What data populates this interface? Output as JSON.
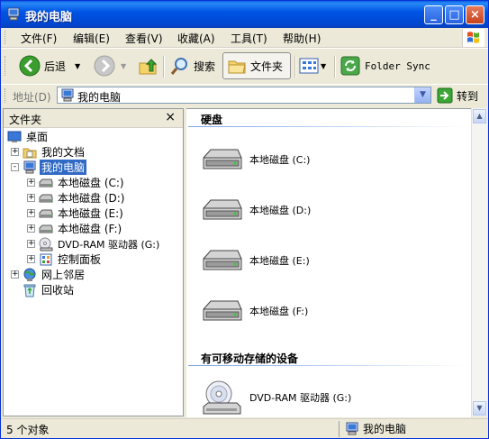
{
  "window": {
    "title": "我的电脑"
  },
  "menu": [
    "文件(F)",
    "编辑(E)",
    "查看(V)",
    "收藏(A)",
    "工具(T)",
    "帮助(H)"
  ],
  "toolbar": {
    "back": "后退",
    "search": "搜索",
    "folders": "文件夹",
    "folder_sync": "Folder Sync"
  },
  "address": {
    "label": "地址(D)",
    "value": "我的电脑",
    "go": "转到"
  },
  "folder_pane": {
    "title": "文件夹",
    "close": "×",
    "items": [
      {
        "label": "桌面",
        "level": 0
      },
      {
        "label": "我的文档",
        "level": 1,
        "expander": "+"
      },
      {
        "label": "我的电脑",
        "level": 1,
        "expander": "-",
        "selected": true
      },
      {
        "label": "本地磁盘 (C:)",
        "level": 2,
        "expander": "+"
      },
      {
        "label": "本地磁盘 (D:)",
        "level": 2,
        "expander": "+"
      },
      {
        "label": "本地磁盘 (E:)",
        "level": 2,
        "expander": "+"
      },
      {
        "label": "本地磁盘 (F:)",
        "level": 2,
        "expander": "+"
      },
      {
        "label": "DVD-RAM 驱动器 (G:)",
        "level": 2,
        "expander": "+"
      },
      {
        "label": "控制面板",
        "level": 2,
        "expander": "+"
      },
      {
        "label": "网上邻居",
        "level": 1,
        "expander": "+"
      },
      {
        "label": "回收站",
        "level": 1
      }
    ]
  },
  "content": {
    "groups": [
      {
        "title": "硬盘",
        "items": [
          "本地磁盘 (C:)",
          "本地磁盘 (D:)",
          "本地磁盘 (E:)",
          "本地磁盘 (F:)"
        ]
      },
      {
        "title": "有可移动存储的设备",
        "items": [
          "DVD-RAM 驱动器 (G:)"
        ]
      }
    ]
  },
  "status": {
    "count": "5 个对象",
    "location": "我的电脑"
  },
  "colors": {
    "titlebar": "#0055e5",
    "selection": "#316ac5",
    "chrome": "#ece9d8"
  }
}
